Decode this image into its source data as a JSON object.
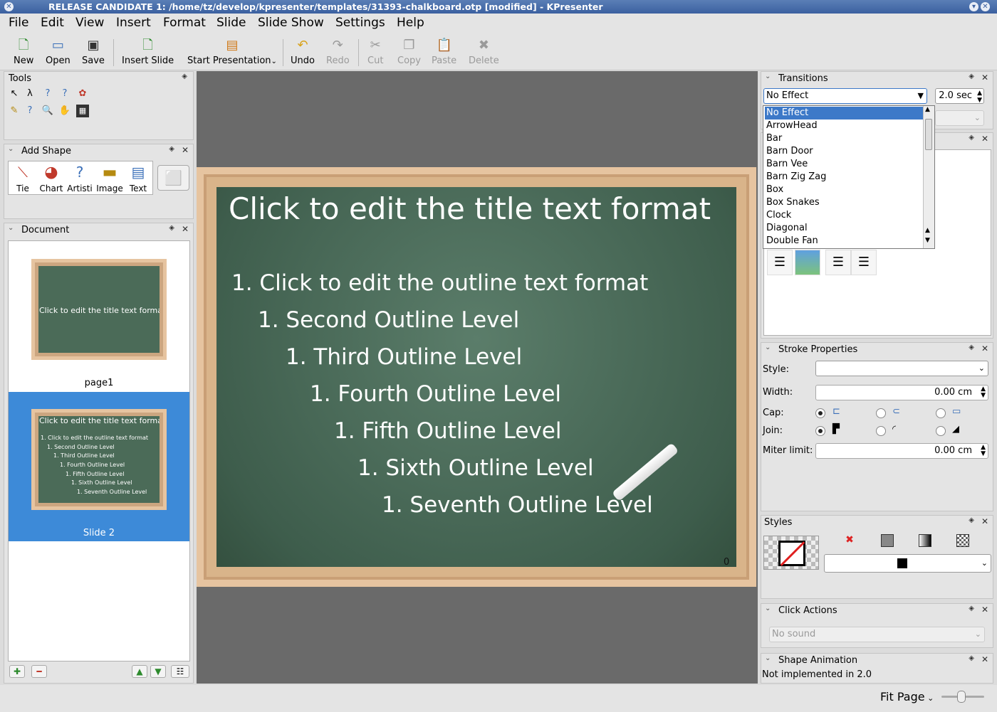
{
  "window": {
    "title": "RELEASE CANDIDATE 1: /home/tz/develop/kpresenter/templates/31393-chalkboard.otp [modified] - KPresenter"
  },
  "menu": [
    "File",
    "Edit",
    "View",
    "Insert",
    "Format",
    "Slide",
    "Slide Show",
    "Settings",
    "Help"
  ],
  "toolbar": {
    "new": "New",
    "open": "Open",
    "save": "Save",
    "insert_slide": "Insert Slide",
    "start_presentation": "Start Presentation",
    "undo": "Undo",
    "redo": "Redo",
    "cut": "Cut",
    "copy": "Copy",
    "paste": "Paste",
    "delete": "Delete"
  },
  "panels": {
    "tools": "Tools",
    "add_shape": "Add Shape",
    "shapes": [
      "Tie",
      "Chart",
      "Artisti",
      "Image",
      "Text"
    ],
    "document": "Document",
    "transitions": "Transitions",
    "stroke": "Stroke Properties",
    "styles": "Styles",
    "click_actions": "Click Actions",
    "shape_animation": "Shape Animation",
    "shape_animation_note": "Not implemented in 2.0"
  },
  "document": {
    "pages": [
      {
        "label": "page1",
        "title": "Click to edit the title text format"
      },
      {
        "label": "Slide 2",
        "title": "Click to edit the title text format",
        "outline": [
          "1. Click to edit the outline text format",
          "1. Second Outline Level",
          "1. Third Outline Level",
          "1. Fourth Outline Level",
          "1. Fifth Outline Level",
          "1. Sixth Outline Level",
          "1. Seventh Outline Level"
        ]
      }
    ]
  },
  "slide": {
    "title": "Click to edit the title text format",
    "outline": [
      "1. Click to edit the outline text format",
      "1. Second Outline Level",
      "1. Third Outline Level",
      "1. Fourth Outline Level",
      "1. Fifth Outline Level",
      "1. Sixth Outline Level",
      "1. Seventh Outline Level"
    ],
    "page_number": "0"
  },
  "transitions": {
    "selected": "No Effect",
    "duration": "2.0 sec",
    "options": [
      "No Effect",
      "ArrowHead",
      "Bar",
      "Barn Door",
      "Barn Vee",
      "Barn Zig Zag",
      "Box",
      "Box Snakes",
      "Clock",
      "Diagonal",
      "Double Fan"
    ]
  },
  "stroke": {
    "style_label": "Style:",
    "width_label": "Width:",
    "width_value": "0.00 cm",
    "cap_label": "Cap:",
    "join_label": "Join:",
    "miter_label": "Miter limit:",
    "miter_value": "0.00 cm"
  },
  "click_actions": {
    "sound": "No sound"
  },
  "status": {
    "zoom": "Fit Page"
  }
}
